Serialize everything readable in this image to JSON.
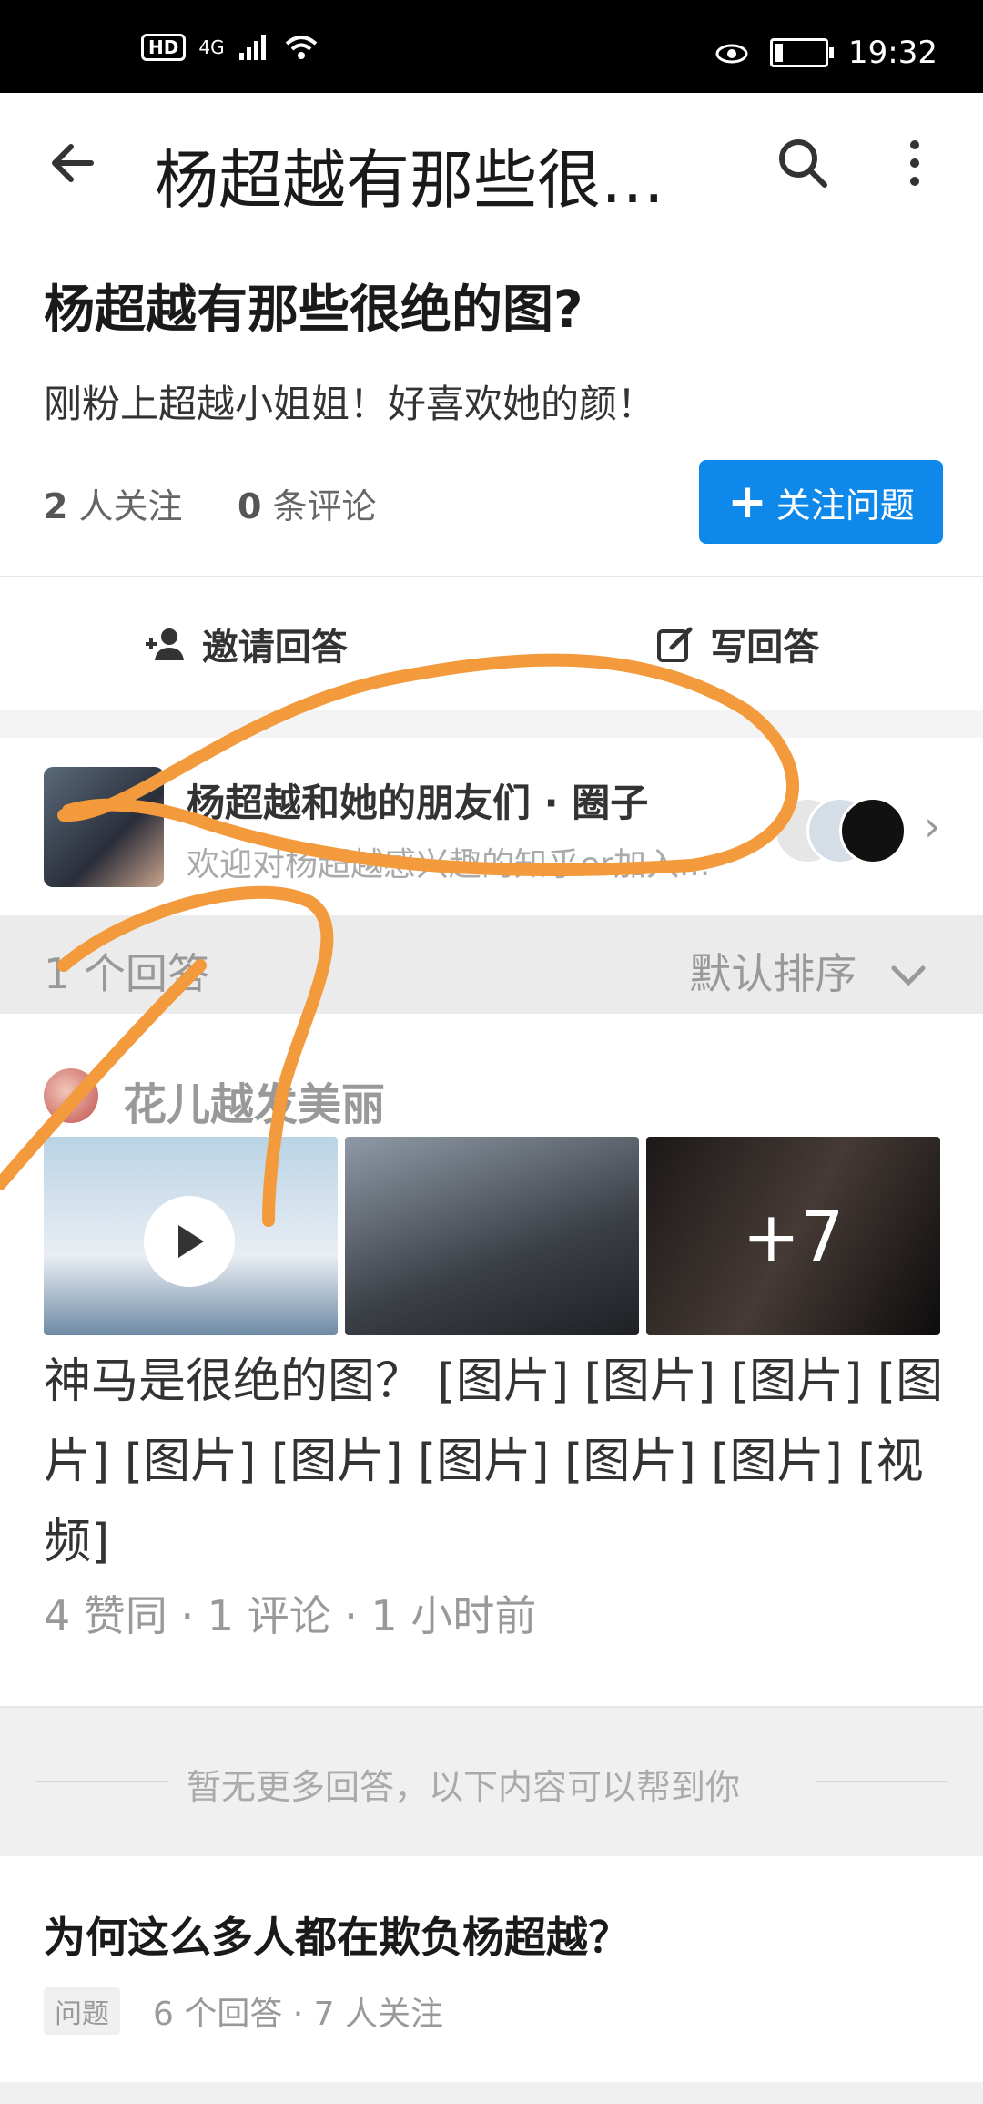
{
  "status_bar": {
    "hd": "HD",
    "network": "4G",
    "time": "19:32",
    "battery_level": 0.15
  },
  "app_bar": {
    "title": "杨超越有那些很…"
  },
  "question": {
    "title": "杨超越有那些很绝的图?",
    "description": "刚粉上超越小姐姐！好喜欢她的颜！",
    "followers_count": "2",
    "followers_label": "人关注",
    "comments_count": "0",
    "comments_label": "条评论",
    "follow_button": "关注问题"
  },
  "actions": {
    "invite": "邀请回答",
    "write": "写回答"
  },
  "circle": {
    "name": "杨超越和她的朋友们 · 圈子",
    "subtitle": "欢迎对杨超越感兴趣的知乎er加入..."
  },
  "answers_header": {
    "count": "1 个回答",
    "sort": "默认排序"
  },
  "answer": {
    "author": "花儿越发美丽",
    "more_images": "+7",
    "excerpt": "神马是很绝的图？ [图片] [图片] [图片] [图片] [图片] [图片] [图片] [图片] [图片] [视频]",
    "stats": "4 赞同 · 1 评论 · 1 小时前"
  },
  "no_more": "暂无更多回答，以下内容可以帮到你",
  "related": {
    "title": "为何这么多人都在欺负杨超越？",
    "tag": "问题",
    "meta": "6 个回答 · 7 人关注"
  },
  "colors": {
    "accent": "#0f88eb",
    "annotation": "#f39a3d"
  }
}
